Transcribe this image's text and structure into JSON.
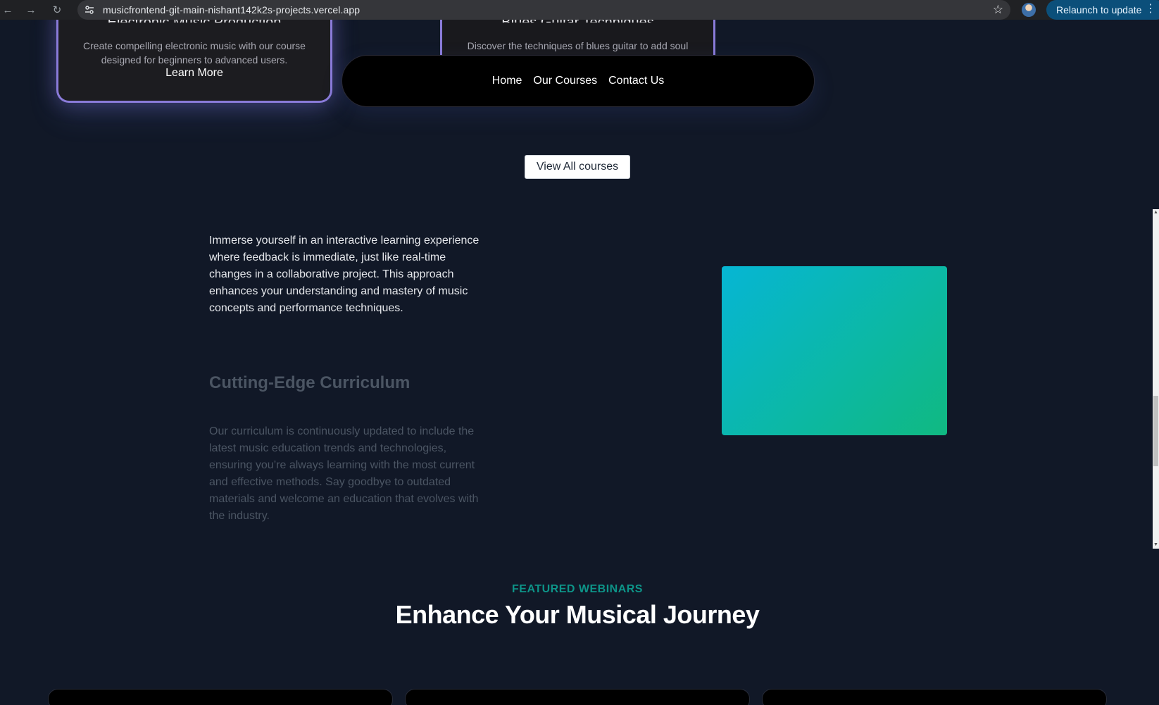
{
  "browser": {
    "url": "musicfrontend-git-main-nishant142k2s-projects.vercel.app",
    "relaunch_label": "Relaunch to update",
    "relaunch_color": "#0b4f7a"
  },
  "cards": [
    {
      "title": "Electronic Music Production",
      "description": "Create compelling electronic music with our course designed for beginners to advanced users.",
      "link": "Learn More"
    },
    {
      "title": "Blues Guitar Techniques",
      "description": "Discover the techniques of blues guitar to add soul"
    }
  ],
  "nav": {
    "items": [
      "Home",
      "Our Courses",
      "Contact Us"
    ]
  },
  "view_all_label": "View All courses",
  "feature": {
    "intro": "Immerse yourself in an interactive learning experience where feedback is immediate, just like real-time changes in a collaborative project. This approach enhances your understanding and mastery of music concepts and performance techniques.",
    "title": "Cutting-Edge Curriculum",
    "description": "Our curriculum is continuously updated to include the latest music education trends and technologies, ensuring you’re always learning with the most current and effective methods. Say goodbye to outdated materials and welcome an education that evolves with the industry."
  },
  "webinars": {
    "eyebrow": "FEATURED WEBINARS",
    "headline": "Enhance Your Musical Journey"
  },
  "colors": {
    "background": "#111827",
    "accent_teal": "#0d9488",
    "gradient_start": "#06b6d4",
    "gradient_end": "#10b981",
    "card_border": "#8a7bd9"
  }
}
